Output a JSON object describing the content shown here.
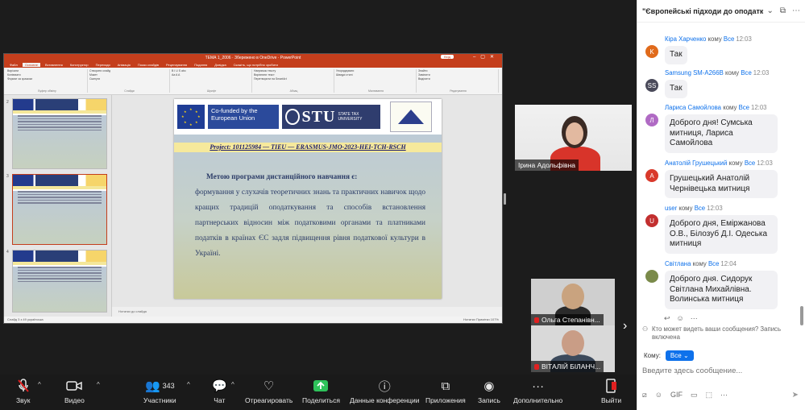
{
  "powerpoint": {
    "window_title": "ТЕМА 1_2006 · Збережено в OneDrive · PowerPoint",
    "sign_in": "Вхід",
    "tabs": [
      "Файл",
      "Основне",
      "Вставлення",
      "Конструктор",
      "Переходи",
      "Анімація",
      "Показ слайдів",
      "Рецензування",
      "Подання",
      "Довідка",
      "Скажіть, що потрібно зробити"
    ],
    "active_tab": "Основне",
    "ribbon_groups": [
      {
        "label": "Буфер обміну",
        "items": [
          "Вирізати",
          "Копіювати",
          "Формат за зразком"
        ]
      },
      {
        "label": "Слайди",
        "items": [
          "Створити слайд",
          "Макет",
          "Скинути",
          "Розділ"
        ]
      },
      {
        "label": "Шрифт",
        "items": [
          "B  I  U  S  abc",
          "Aa  A  A"
        ]
      },
      {
        "label": "Абзац",
        "items": [
          "Напрямок тексту",
          "Вирівняти текст",
          "Перетворити на SmartArt"
        ]
      },
      {
        "label": "Малювання",
        "items": [
          "Упорядкувати",
          "Швидкі стилі"
        ]
      },
      {
        "label": "Редагування",
        "items": [
          "Знайти",
          "Замінити",
          "Виділити"
        ]
      }
    ],
    "thumb_numbers": [
      "2",
      "3",
      "4"
    ],
    "slide": {
      "cofunded": "Co-funded by the European Union",
      "stu_big": "STU",
      "stu_small": "STATE TAX UNIVERSITY",
      "project_line": "Project: 101125984 — TIEU — ERASMUS-JMO-2023-HEI-TCH-RSCH",
      "lead": "Метою програми дистанційного навчання є:",
      "body": "формування у слухачів теоретичних знань та практичних навичок щодо кращих традицій оподаткування та способів встановлення партнерських відносин між податковими органами та платниками податків в країнах ЄС задля підвищення рівня податкової культури в Україні."
    },
    "notes": "Нотатки до слайда",
    "status_left": "Слайд 3 з 49   українська",
    "status_right": "Нотатки   Примітки   107%"
  },
  "tiles": {
    "irina": "Ірина Адольфівна",
    "olga": "Ольга Степанівн...",
    "vitaliy": "ВІТАЛІЙ БІЛАНЧ..."
  },
  "toolbar": {
    "audio": "Звук",
    "video": "Видео",
    "participants": "Участники",
    "participants_count": "343",
    "chat": "Чат",
    "react": "Отреагировать",
    "share": "Поделиться",
    "info": "Данные конференции",
    "apps": "Приложения",
    "record": "Запись",
    "more": "Дополнительно",
    "leave": "Выйти"
  },
  "chat": {
    "title": "\"Європейські підходи до оподатк...",
    "messages": [
      {
        "who": "Кіра Харченко",
        "to": "кому",
        "all": "Все",
        "time": "12:03",
        "initial": "K",
        "color": "#e06a1b",
        "text": "Так"
      },
      {
        "who": "Samsung SM-A266B",
        "to": "кому",
        "all": "Все",
        "time": "12:03",
        "initial": "SS",
        "color": "#4a4a5a",
        "text": "Так"
      },
      {
        "who": "Лариса Самойлова",
        "to": "кому",
        "all": "Все",
        "time": "12:03",
        "initial": "Л",
        "color": "#b06ac4",
        "text": "Доброго дня! Сумська митниця, Лариса Самойлова"
      },
      {
        "who": "Анатолій Грушецький",
        "to": "кому",
        "all": "Все",
        "time": "12:03",
        "initial": "А",
        "color": "#d9392b",
        "text": "Грушецький Анатолій Чернівецька митниця"
      },
      {
        "who": "user",
        "to": "кому",
        "all": "Все",
        "time": "12:03",
        "initial": "U",
        "color": "#c22f2f",
        "text": "Доброго дня, Еміржанова О.В., Білозуб Д.І. Одеська митниця"
      },
      {
        "who": "Світлана",
        "to": "кому",
        "all": "Все",
        "time": "12:04",
        "initial": "",
        "color": "#7a8a4a",
        "text": "Доброго дня. Сидорук Світлана Михайлівна. Волинська митниця"
      }
    ],
    "privacy": "Кто может видеть ваши сообщения? Запись включена",
    "to_label": "Кому:",
    "to_value": "Все",
    "input_placeholder": "Введите здесь сообщение..."
  }
}
